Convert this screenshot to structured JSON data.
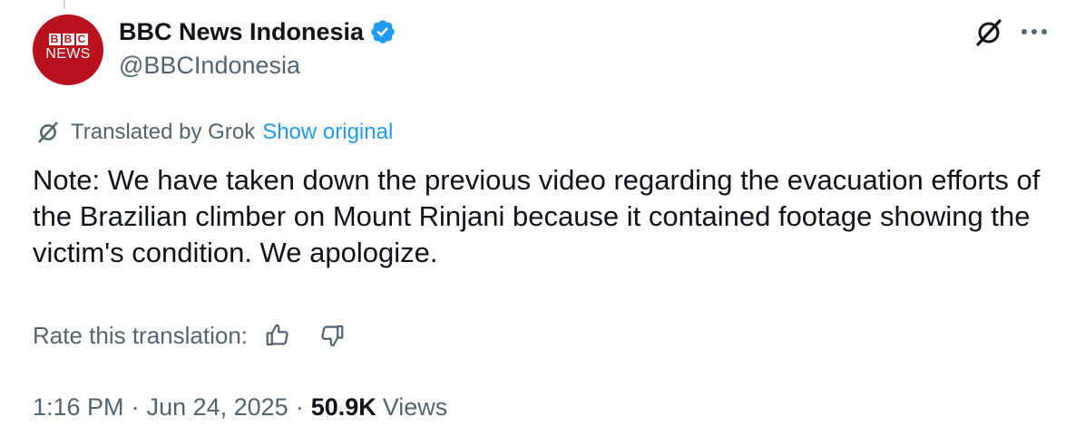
{
  "account": {
    "display_name": "BBC News Indonesia",
    "handle": "@BBCIndonesia",
    "verified": true,
    "avatar": {
      "letters": [
        "B",
        "B",
        "C"
      ],
      "sub_label": "NEWS",
      "color": "#b8121e"
    }
  },
  "translation": {
    "label": "Translated by Grok",
    "show_original_label": "Show original"
  },
  "tweet": {
    "text": "Note: We have taken down the previous video regarding the evacuation efforts of the Brazilian climber on Mount Rinjani because it contained footage showing the victim's condition. We apologize."
  },
  "rating": {
    "label": "Rate this translation:",
    "icons": [
      "thumbs-up-icon",
      "thumbs-down-icon"
    ]
  },
  "meta": {
    "time": "1:16 PM",
    "date": "Jun 24, 2025",
    "separator": "·",
    "views_count": "50.9K",
    "views_label": "Views"
  },
  "colors": {
    "text": "#0f1419",
    "secondary": "#536471",
    "link": "#1d9bf0",
    "verified": "#1d9bf0",
    "brand": "#b8121e"
  }
}
